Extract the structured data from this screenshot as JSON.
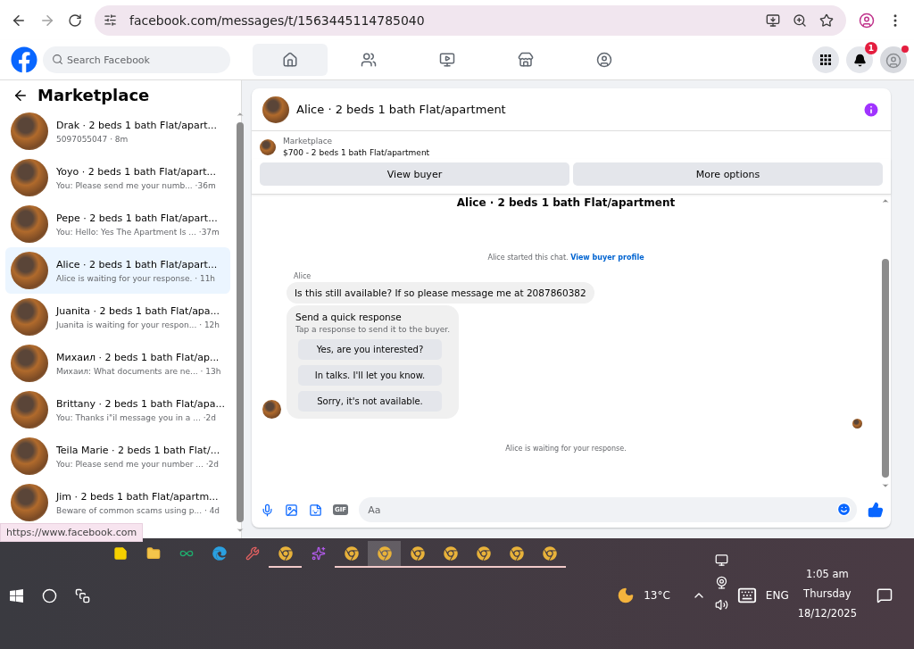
{
  "browser": {
    "url": "facebook.com/messages/t/1563445114785040",
    "status_link": "https://www.facebook.com"
  },
  "header": {
    "search_placeholder": "Search Facebook",
    "nav": [
      {
        "kind": "home",
        "selected": true
      },
      {
        "kind": "friends",
        "selected": false
      },
      {
        "kind": "video",
        "selected": false
      },
      {
        "kind": "marketplace",
        "selected": false
      },
      {
        "kind": "groups",
        "selected": false
      }
    ],
    "notification_count": "1",
    "profile_dot": true
  },
  "sidebar": {
    "title": "Marketplace",
    "conversations": [
      {
        "title": "Drak · 2 beds 1 bath Flat/apart...",
        "preview": "5097055047",
        "time": "· 8m",
        "selected": false
      },
      {
        "title": "Yoyo · 2 beds 1 bath Flat/apart...",
        "preview": "You: Please send me your numb...",
        "time": "·36m",
        "selected": false
      },
      {
        "title": "Pepe · 2 beds 1 bath Flat/apart...",
        "preview": "You: Hello: Yes The Apartment Is ...",
        "time": "·37m",
        "selected": false
      },
      {
        "title": "Alice · 2 beds 1 bath Flat/apart...",
        "preview": "Alice is waiting for your response.",
        "time": "· 11h",
        "selected": true
      },
      {
        "title": "Juanita · 2 beds 1 bath Flat/apa...",
        "preview": "Juanita is waiting for your respon...",
        "time": "· 12h",
        "selected": false
      },
      {
        "title": "Михаил · 2 beds 1 bath Flat/ap...",
        "preview": "Михаил: What documents are ne...",
        "time": "· 13h",
        "selected": false
      },
      {
        "title": "Brittany · 2 beds 1 bath Flat/apa...",
        "preview": "You: Thanks i\"il message you in a ...",
        "time": "·2d",
        "selected": false
      },
      {
        "title": "Teila Marie · 2 beds 1 bath Flat/...",
        "preview": "You: Please send me your number ...",
        "time": "·2d",
        "selected": false
      },
      {
        "title": "Jim · 2 beds 1 bath Flat/apartm...",
        "preview": "Beware of common scams using p...",
        "time": "· 4d",
        "selected": false
      }
    ]
  },
  "chat": {
    "title": "Alice · 2 beds 1 bath Flat/apartment",
    "listing": {
      "source": "Marketplace",
      "item": "$700 - 2 beds 1 bath Flat/apartment"
    },
    "actions": [
      "View buyer",
      "More options"
    ],
    "thread_title": "Alice · 2 beds 1 bath Flat/apartment",
    "started_note": "Alice started this chat.",
    "profile_link": "View buyer profile",
    "sender": "Alice",
    "message": "Is this still available? If so please message me at 2087860382",
    "quick": {
      "title": "Send a quick response",
      "hint": "Tap a response to send it to the buyer.",
      "options": [
        "Yes, are you interested?",
        "In talks. I'll let you know.",
        "Sorry, it's not available."
      ]
    },
    "waiting_note": "Alice is waiting for your response.",
    "composer": {
      "gif_label": "GIF",
      "placeholder": "Aa"
    }
  },
  "taskbar": {
    "apps": [
      {
        "kind": "notes",
        "running": false,
        "selected": false
      },
      {
        "kind": "folder",
        "running": false,
        "selected": false
      },
      {
        "kind": "green",
        "running": false,
        "selected": false
      },
      {
        "kind": "edge",
        "running": false,
        "selected": false
      },
      {
        "kind": "tool",
        "running": false,
        "selected": false
      },
      {
        "kind": "chrome",
        "running": true,
        "selected": false
      },
      {
        "kind": "copilot",
        "running": false,
        "selected": false
      },
      {
        "kind": "chrome",
        "running": true,
        "selected": false
      },
      {
        "kind": "chrome",
        "running": true,
        "selected": true
      },
      {
        "kind": "chrome",
        "running": true,
        "selected": false
      },
      {
        "kind": "chrome",
        "running": true,
        "selected": false
      },
      {
        "kind": "chrome",
        "running": true,
        "selected": false
      },
      {
        "kind": "chrome",
        "running": true,
        "selected": false
      },
      {
        "kind": "chrome",
        "running": true,
        "selected": false
      }
    ],
    "temperature": "13°C",
    "language": "ENG",
    "time": "1:05 am",
    "day": "Thursday",
    "date": "18/12/2025"
  }
}
